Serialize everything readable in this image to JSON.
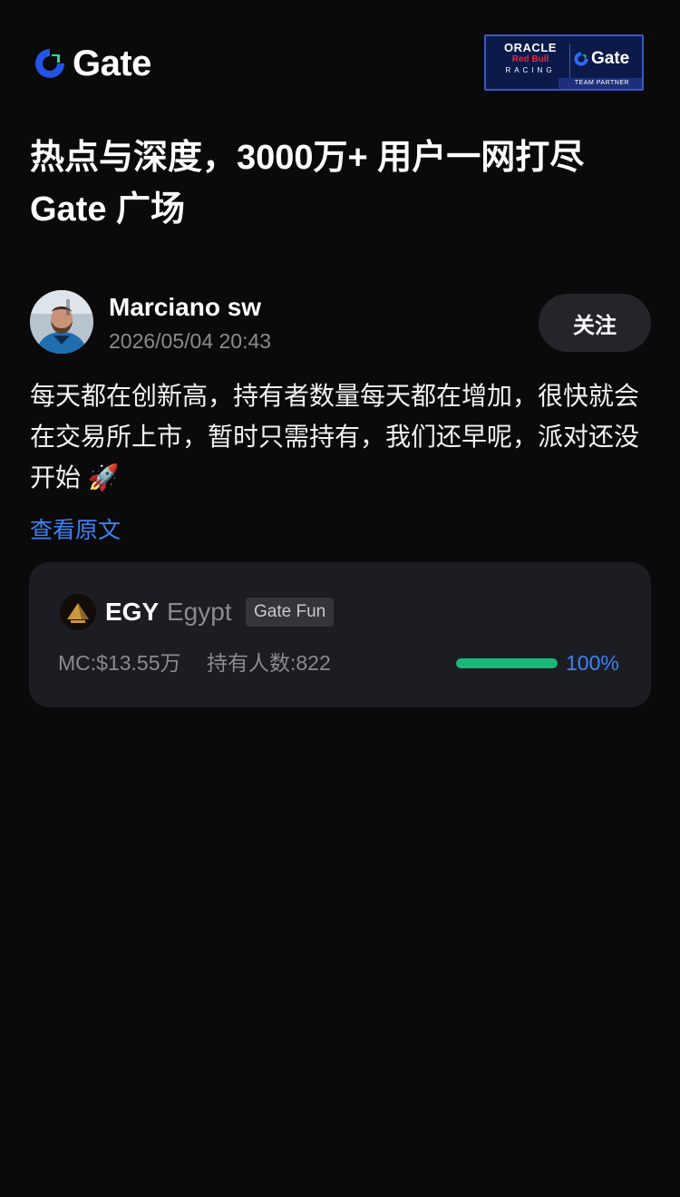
{
  "header": {
    "logo_text": "Gate",
    "partner": {
      "oracle": "ORACLE",
      "redbull": "Red Bull",
      "racing": "RACING",
      "gate": "Gate",
      "strip": "TEAM PARTNER"
    }
  },
  "headline": {
    "line1": "热点与深度，3000万+ 用户一网打尽",
    "line2": "Gate 广场"
  },
  "post": {
    "author": "Marciano sw",
    "time": "2026/05/04 20:43",
    "follow_label": "关注",
    "body": "每天都在创新高，持有者数量每天都在增加，很快就会在交易所上市，暂时只需持有，我们还早呢，派对还没开始 🚀",
    "view_original": "查看原文"
  },
  "token": {
    "symbol": "EGY",
    "name": "Egypt",
    "tag": "Gate Fun",
    "market_cap": "MC:$13.55万",
    "holders": "持有人数:822",
    "progress": 1.0,
    "progress_label": "100%",
    "progress_color": "#1bb87c"
  },
  "colors": {
    "background": "#0a0a0b",
    "accent_blue": "#3d83f6",
    "brand_green": "#17e6a1",
    "brand_blue": "#2354e6"
  }
}
